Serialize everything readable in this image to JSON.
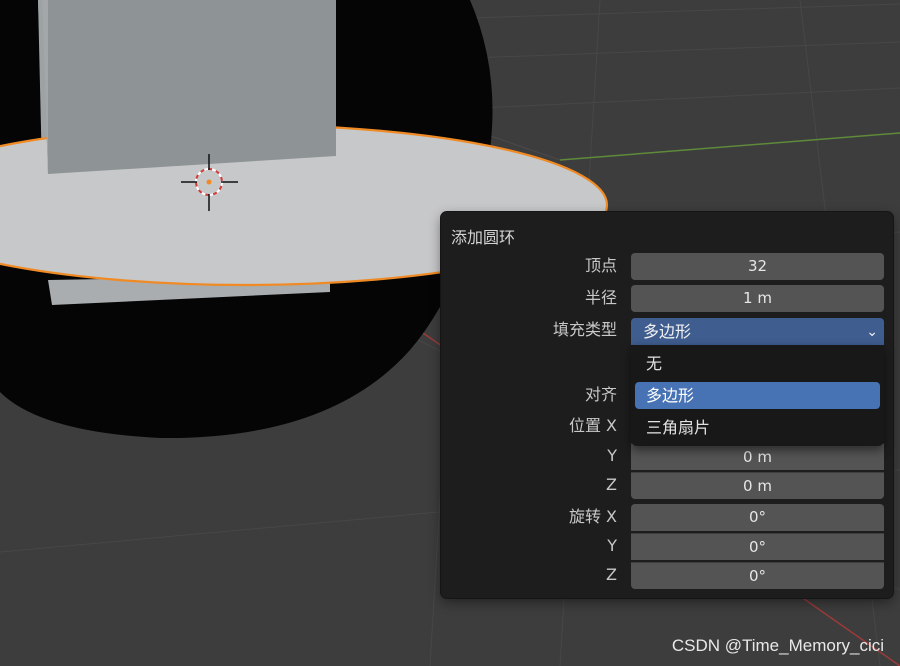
{
  "panel": {
    "title": "添加圆环",
    "vertices": {
      "label": "顶点",
      "value": "32"
    },
    "radius": {
      "label": "半径",
      "value": "1 m"
    },
    "fill_type": {
      "label": "填充类型",
      "value": "多边形",
      "options": [
        "无",
        "多边形",
        "三角扇片"
      ],
      "selected_index": 1
    },
    "align": {
      "label": "对齐"
    },
    "location": {
      "label_x": "位置 X",
      "label_y": "Y",
      "label_z": "Z",
      "y": "0 m",
      "z": "0 m"
    },
    "rotation": {
      "label_x": "旋转 X",
      "label_y": "Y",
      "label_z": "Z",
      "x": "0°",
      "y": "0°",
      "z": "0°"
    }
  },
  "watermark": "CSDN @Time_Memory_cici",
  "colors": {
    "viewport_bg": "#3d3d3d",
    "selection_outline": "#f08a24",
    "panel_bg": "#1d1d1d",
    "field_bg": "#545454",
    "select_active": "#3f5d8f",
    "menu_highlight": "#4772b3"
  }
}
